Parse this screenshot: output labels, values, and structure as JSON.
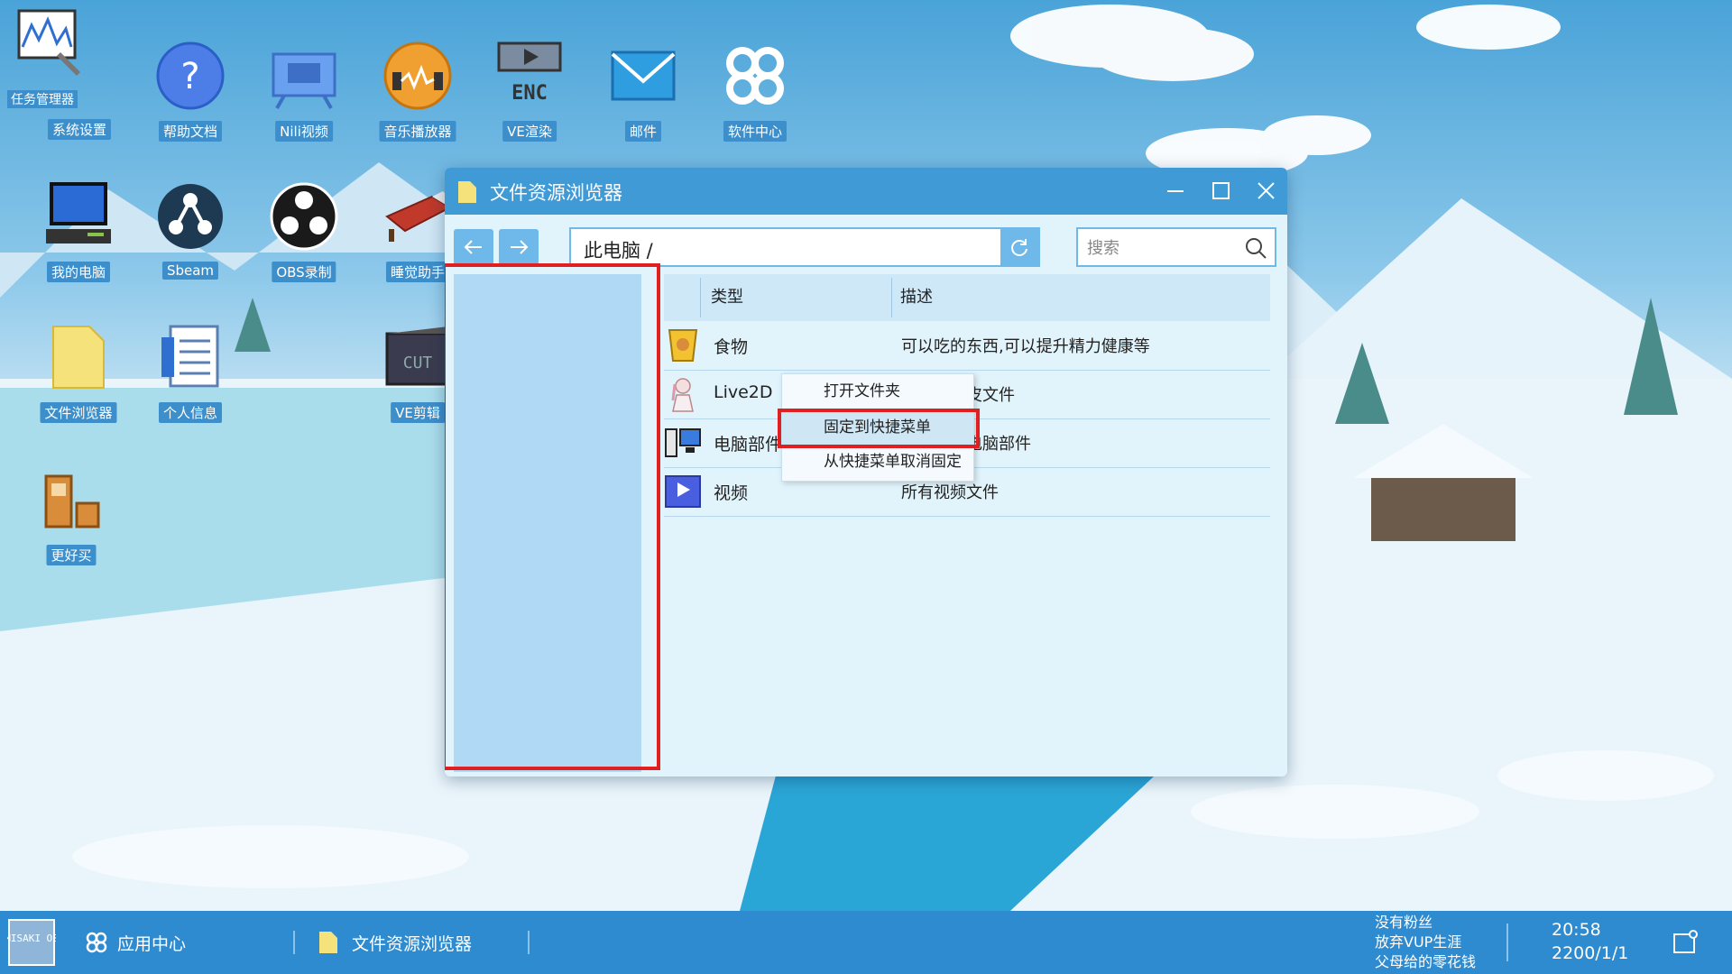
{
  "desktop": {
    "icons": [
      {
        "label": "系统设置",
        "badge": "任务管理器"
      },
      {
        "label": "帮助文档"
      },
      {
        "label": "Nili视频"
      },
      {
        "label": "音乐播放器"
      },
      {
        "label": "VE渲染"
      },
      {
        "label": "邮件"
      },
      {
        "label": "软件中心"
      },
      {
        "label": "我的电脑"
      },
      {
        "label": "Sbeam"
      },
      {
        "label": "OBS录制"
      },
      {
        "label": "睡觉助手"
      },
      {
        "label": "文件浏览器"
      },
      {
        "label": "个人信息"
      },
      {
        "label": "VE剪辑"
      },
      {
        "label": "更好买"
      }
    ]
  },
  "window": {
    "title": "文件资源浏览器",
    "address": "此电脑 /",
    "search_placeholder": "搜索",
    "columns": {
      "type": "类型",
      "description": "描述"
    },
    "rows": [
      {
        "name": "食物",
        "description": "可以吃的东西,可以提升精力健康等",
        "icon": "food-icon"
      },
      {
        "name": "Live2D",
        "description": "以主播套皮文件",
        "icon": "live2d-icon"
      },
      {
        "name": "电脑部件",
        "description": "装或修改电脑部件",
        "icon": "computer-parts-icon"
      },
      {
        "name": "视频",
        "description": "所有视频文件",
        "icon": "video-icon"
      }
    ]
  },
  "context_menu": {
    "items": [
      "打开文件夹",
      "固定到快捷菜单",
      "从快捷菜单取消固定"
    ]
  },
  "taskbar": {
    "start_logo": "MISAKI OS",
    "app_center": "应用中心",
    "task_explorer": "文件资源浏览器",
    "tray": [
      "没有粉丝",
      "放弃VUP生涯",
      "父母给的零花钱"
    ],
    "time": "20:58",
    "date": "2200/1/1"
  },
  "colors": {
    "accent": "#3f9ad6",
    "sidebar": "#afd9f5",
    "highlight": "#e02020",
    "taskbar": "#2e8bd0"
  }
}
